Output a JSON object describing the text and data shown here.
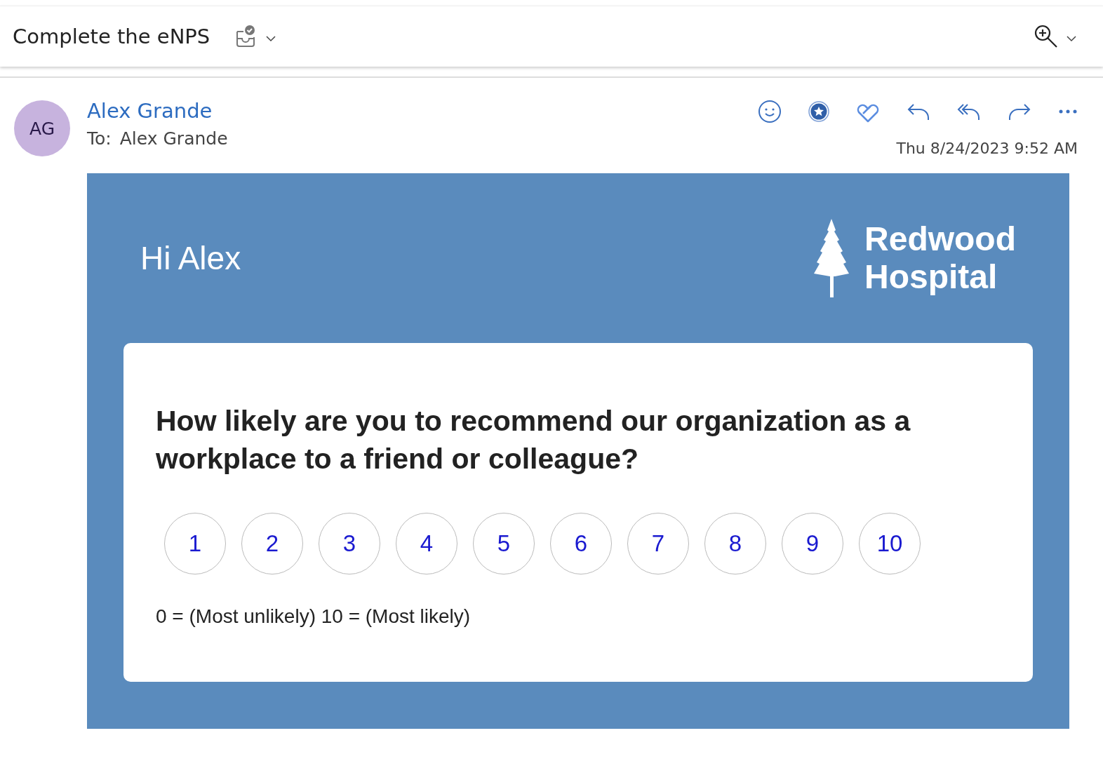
{
  "subject": "Complete the eNPS",
  "sender": {
    "initials": "AG",
    "name": "Alex Grande",
    "to_label": "To:",
    "to": "Alex Grande",
    "date": "Thu 8/24/2023 9:52 AM"
  },
  "email": {
    "greeting": "Hi Alex",
    "logo_lines": [
      "Redwood",
      "Hospital"
    ],
    "question": "How likely are you to recommend our organization as a workplace to a friend or colleague?",
    "scores": [
      {
        "label": "1",
        "selected": false
      },
      {
        "label": "2",
        "selected": false
      },
      {
        "label": "3",
        "selected": false
      },
      {
        "label": "4",
        "selected": false
      },
      {
        "label": "5",
        "selected": false
      },
      {
        "label": "6",
        "selected": false
      },
      {
        "label": "7",
        "selected": false
      },
      {
        "label": "8",
        "selected": false
      },
      {
        "label": "9",
        "selected": false
      },
      {
        "label": "10",
        "selected": false
      }
    ],
    "scale_note": "0 = (Most unlikely) 10 = (Most likely)"
  }
}
